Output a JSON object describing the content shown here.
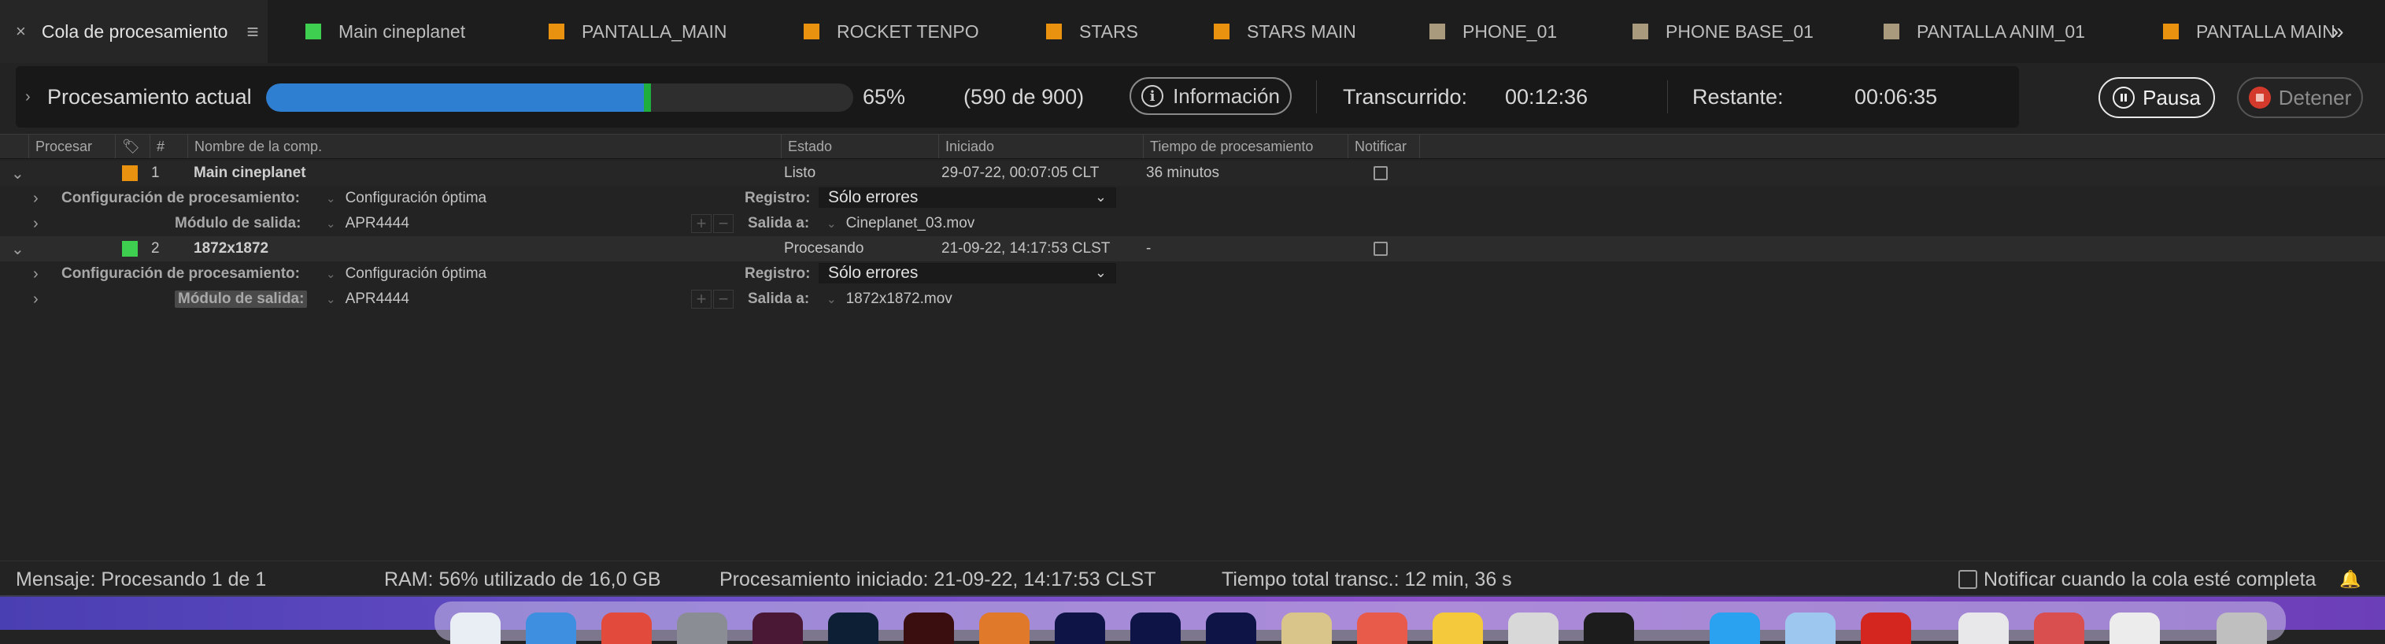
{
  "tabs": {
    "active": {
      "label": "Cola de procesamiento",
      "close_icon": "close-icon",
      "menu_icon": "panel-menu-icon"
    },
    "comps": [
      {
        "label": "Main cineplanet",
        "color": "#3fcf50"
      },
      {
        "label": "PANTALLA_MAIN",
        "color": "#e8920f"
      },
      {
        "label": "ROCKET TENPO",
        "color": "#e8920f"
      },
      {
        "label": "STARS",
        "color": "#e8920f"
      },
      {
        "label": "STARS MAIN",
        "color": "#e8920f"
      },
      {
        "label": "PHONE_01",
        "color": "#a99a7d"
      },
      {
        "label": "PHONE BASE_01",
        "color": "#a99a7d"
      },
      {
        "label": "PANTALLA ANIM_01",
        "color": "#a99a7d"
      },
      {
        "label": "PANTALLA MAIN",
        "color": "#e8920f"
      }
    ],
    "more_icon": "double-chevron-right-icon"
  },
  "progress": {
    "label": "Procesamiento actual",
    "fraction": 0.6556,
    "percent": "65%",
    "frames": "(590 de 900)",
    "info_label": "Información",
    "elapsed_label": "Transcurrido:",
    "elapsed_value": "00:12:36",
    "remaining_label": "Restante:",
    "remaining_value": "00:06:35",
    "pause_label": "Pausa",
    "stop_label": "Detener",
    "bar_color": "#2e7fd1",
    "bar_tick_color": "#1fae3e"
  },
  "columns": {
    "render": "Procesar",
    "num": "#",
    "comp": "Nombre de la comp.",
    "status": "Estado",
    "started": "Iniciado",
    "time": "Tiempo de procesamiento",
    "notify": "Notificar"
  },
  "items": [
    {
      "num": "1",
      "color": "#e8920f",
      "name": "Main cineplanet",
      "status": "Listo",
      "started": "29-07-22, 00:07:05 CLT",
      "time": "36 minutos",
      "settings_label": "Configuración de procesamiento:",
      "settings_value": "Configuración óptima",
      "log_label": "Registro:",
      "log_value": "Sólo errores",
      "module_label": "Módulo de salida:",
      "module_value": "APR4444",
      "output_label": "Salida a:",
      "output_value": "Cineplanet_03.mov"
    },
    {
      "num": "2",
      "color": "#3fcf50",
      "name": "1872x1872",
      "status": "Procesando",
      "started": "21-09-22, 14:17:53 CLST",
      "time": "-",
      "settings_label": "Configuración de procesamiento:",
      "settings_value": "Configuración óptima",
      "log_label": "Registro:",
      "log_value": "Sólo errores",
      "module_label": "Módulo de salida:",
      "module_value": "APR4444",
      "output_label": "Salida a:",
      "output_value": "1872x1872.mov"
    }
  ],
  "footer": {
    "message": "Mensaje: Procesando 1 de 1",
    "ram": "RAM: 56% utilizado de 16,0 GB",
    "render_started": "Procesamiento iniciado: 21-09-22, 14:17:53 CLST",
    "total_time": "Tiempo total transc.: 12 min, 36 s",
    "notify_label": "Notificar cuando la cola esté completa"
  }
}
